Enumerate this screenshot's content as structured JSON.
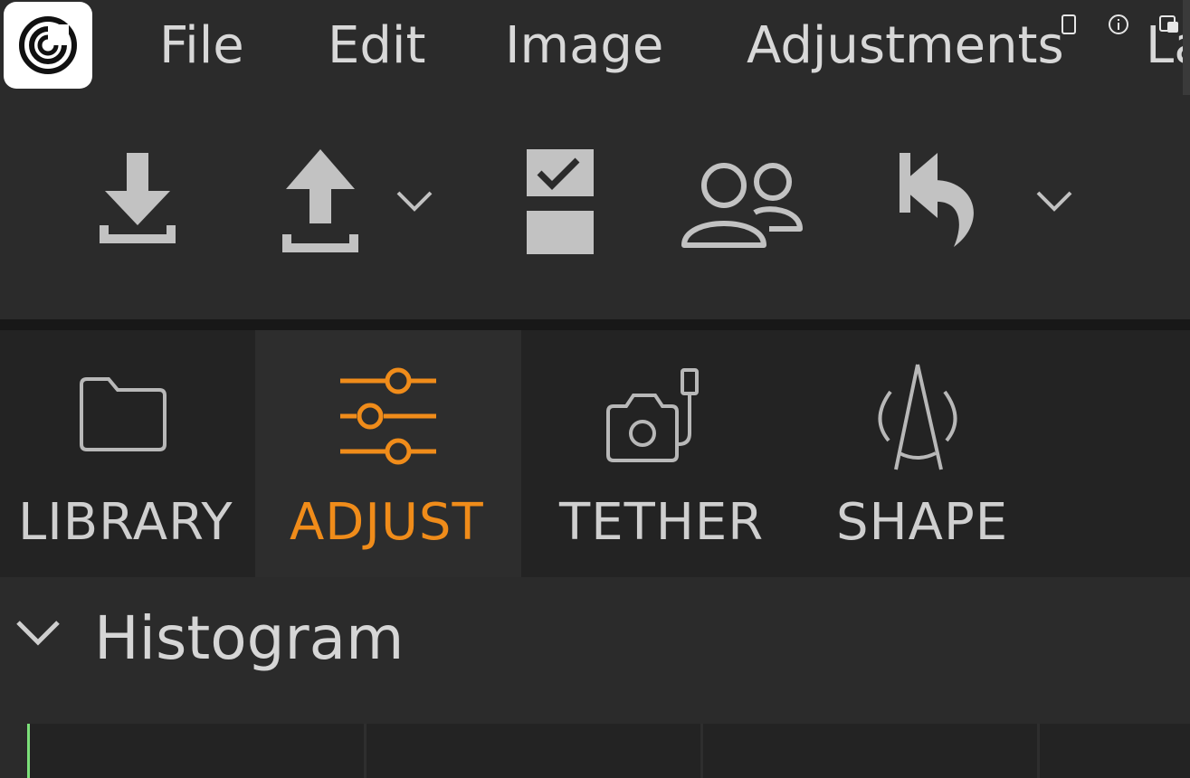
{
  "menubar": {
    "items": [
      "File",
      "Edit",
      "Image",
      "Adjustments",
      "La"
    ]
  },
  "toolbar": {
    "icons": [
      "import-icon",
      "export-icon",
      "chevron-down-icon",
      "checklist-icon",
      "users-icon",
      "undo-icon",
      "chevron-down-icon"
    ]
  },
  "tabs": [
    {
      "label": "LIBRARY",
      "icon": "folder-icon",
      "active": false
    },
    {
      "label": "ADJUST",
      "icon": "sliders-icon",
      "active": true
    },
    {
      "label": "TETHER",
      "icon": "tethered-camera-icon",
      "active": false
    },
    {
      "label": "SHAPE",
      "icon": "compass-icon",
      "active": false
    }
  ],
  "panel": {
    "title": "Histogram",
    "expanded": true
  },
  "colors": {
    "accent": "#f08c1a",
    "background": "#2b2b2b",
    "text": "#d8d8d8",
    "histogram_line": "#7ce07a"
  }
}
